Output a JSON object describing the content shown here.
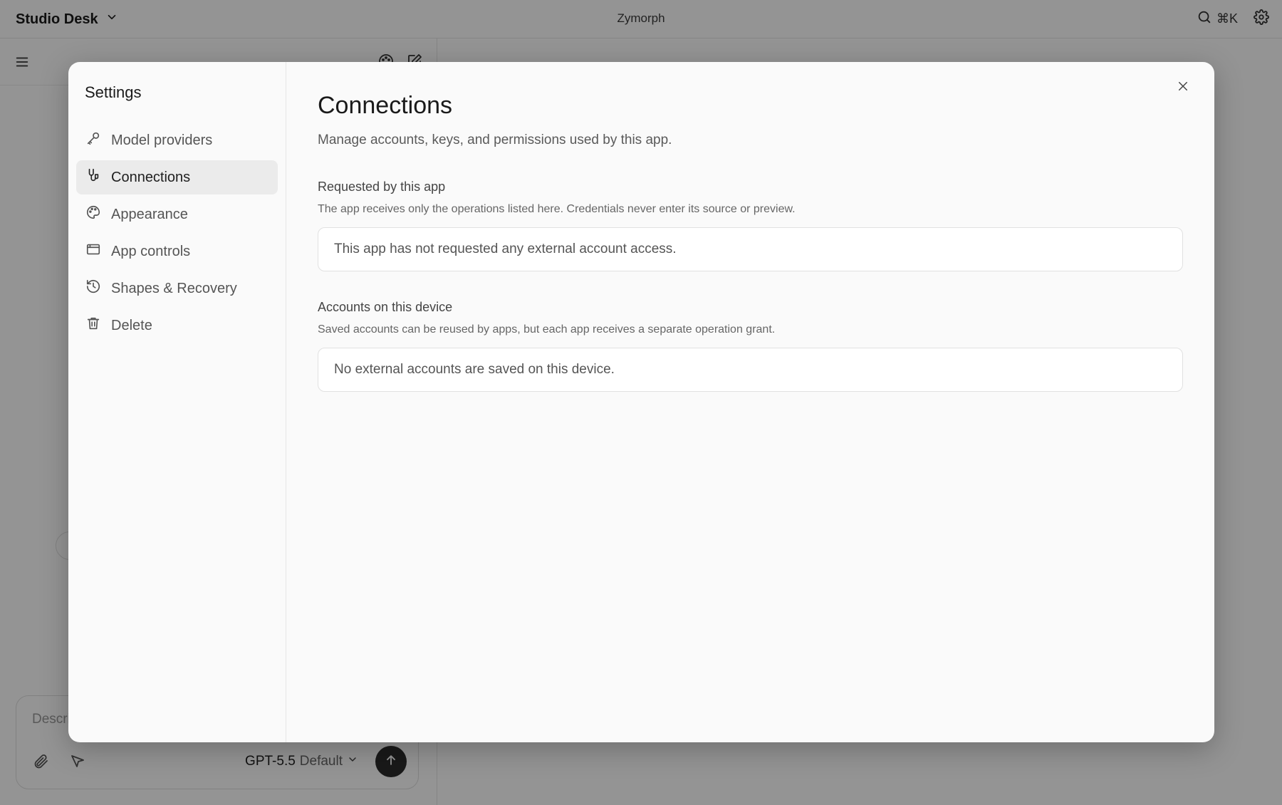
{
  "topbar": {
    "workspace_name": "Studio Desk",
    "app_title": "Zymorph",
    "search_shortcut": "⌘K"
  },
  "composer": {
    "placeholder": "Describe",
    "model_name": "GPT-5.5",
    "model_mode": "Default"
  },
  "settings": {
    "title": "Settings",
    "nav": [
      {
        "label": "Model providers",
        "icon": "key-icon"
      },
      {
        "label": "Connections",
        "icon": "connections-icon",
        "active": true
      },
      {
        "label": "Appearance",
        "icon": "palette-icon"
      },
      {
        "label": "App controls",
        "icon": "window-icon"
      },
      {
        "label": "Shapes & Recovery",
        "icon": "history-icon"
      },
      {
        "label": "Delete",
        "icon": "trash-icon"
      }
    ],
    "page": {
      "title": "Connections",
      "description": "Manage accounts, keys, and permissions used by this app.",
      "requested": {
        "title": "Requested by this app",
        "description": "The app receives only the operations listed here. Credentials never enter its source or preview.",
        "empty": "This app has not requested any external account access."
      },
      "accounts": {
        "title": "Accounts on this device",
        "description": "Saved accounts can be reused by apps, but each app receives a separate operation grant.",
        "empty": "No external accounts are saved on this device."
      }
    }
  }
}
